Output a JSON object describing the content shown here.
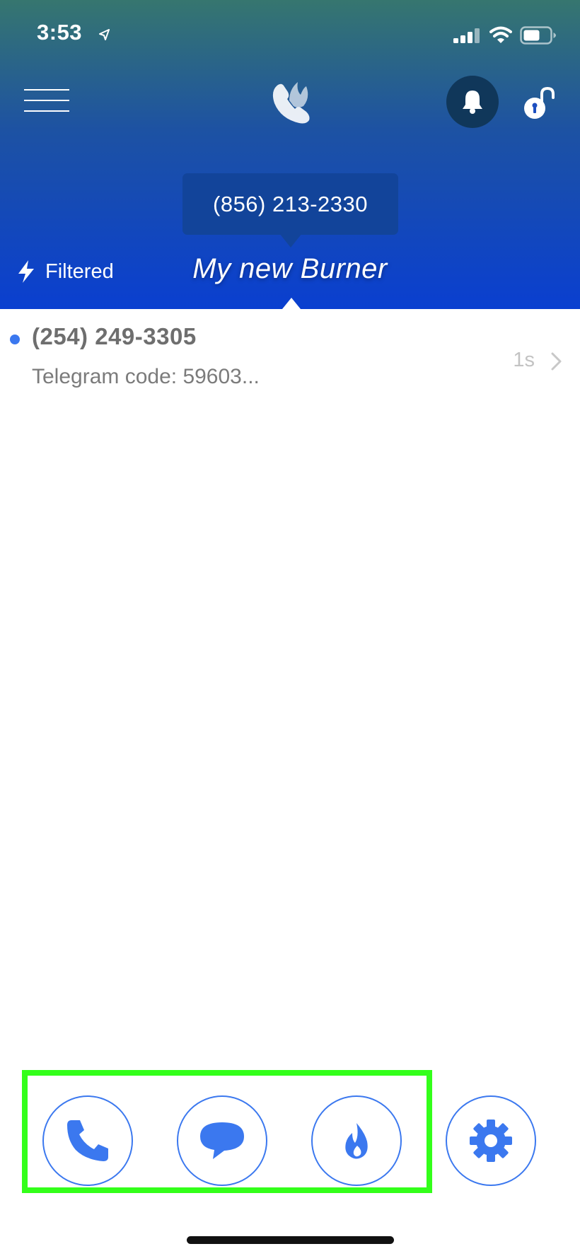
{
  "status_bar": {
    "time": "3:53"
  },
  "header": {
    "phone_number": "(856) 213-2330",
    "filter_label": "Filtered",
    "burner_name": "My new Burner"
  },
  "messages": [
    {
      "from": "(254) 249-3305",
      "preview": "Telegram code: 59603...",
      "time": "1s",
      "unread": true
    }
  ],
  "colors": {
    "accent": "#3b78ef",
    "header_top": "#36766f",
    "header_bottom": "#0a3fd0",
    "highlight": "#33ff1a"
  },
  "icons": {
    "menu": "hamburger-icon",
    "logo": "burner-logo-icon",
    "bell": "bell-icon",
    "lock": "unlock-icon",
    "filter": "lightning-icon",
    "nav": [
      "phone-icon",
      "chat-bubble-icon",
      "flame-icon",
      "gear-icon"
    ]
  }
}
